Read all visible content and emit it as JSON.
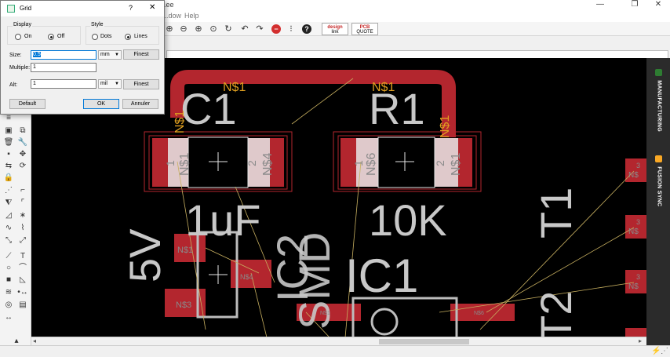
{
  "window": {
    "title": "...ee",
    "minimize": "—",
    "restore": "❐",
    "close": "✕"
  },
  "menu": {
    "items": [
      "...dow",
      "Help"
    ]
  },
  "toolbar": {
    "badges": [
      {
        "top": "design",
        "bottom": "link"
      },
      {
        "top": "PCB",
        "bottom": "QUOTE"
      }
    ]
  },
  "dialog": {
    "title": "Grid",
    "help": "?",
    "close": "✕",
    "display": {
      "label": "Display",
      "on": "On",
      "off": "Off",
      "selected": "Off"
    },
    "style": {
      "label": "Style",
      "dots": "Dots",
      "lines": "Lines",
      "selected": "Lines"
    },
    "size": {
      "label": "Size:",
      "value": "0.5",
      "unit": "mm",
      "finest": "Finest"
    },
    "multiple": {
      "label": "Multiple:",
      "value": "1"
    },
    "alt": {
      "label": "Alt:",
      "value": "1",
      "unit": "mil",
      "finest": "Finest"
    },
    "buttons": {
      "default": "Default",
      "ok": "OK",
      "cancel": "Annuler"
    }
  },
  "right_panel": {
    "manufacturing": {
      "label": "MANUFACTURING",
      "color": "#2e7d32"
    },
    "fusion_sync": {
      "label": "FUSION SYNC",
      "color": "#f9a825"
    }
  },
  "board": {
    "colors": {
      "background": "#000000",
      "copper": "#b3262e",
      "silk_label": "#c8c8c8",
      "net_label": "#e0a020",
      "pad_overlay": "#e6e6e6",
      "airwire": "#c8b060"
    },
    "labels": {
      "c1": "C1",
      "r1": "R1",
      "c1_value": "1uF",
      "r1_value": "10K",
      "ic1": "IC1",
      "ic2": "IC2",
      "smd": "SMD",
      "v5": "5V",
      "t1": "T1",
      "t2": "T2",
      "net_top_left": "N$1",
      "net_top_right": "N$1",
      "net_c1_left": "N$1",
      "net_r1_right": "N$1",
      "c1_pad1": "N$1",
      "c1_pad2": "N$4",
      "r1_pad1": "N$6",
      "r1_pad2": "N$1",
      "pad_one_a": "1",
      "pad_two_a": "2",
      "pad_one_b": "1",
      "pad_two_b": "2",
      "ic_pad_a": "N$1",
      "ic_pad_b": "N$3",
      "ic_pad_c": "N$4",
      "ic1_pad_left": "N$1",
      "ic1_pad_right": "N$6",
      "right_pad_a": "N$",
      "right_pad_b": "N$",
      "right_pad_c": "N$",
      "right_pad_a_num": "3",
      "right_pad_b_num": "3",
      "right_pad_c_num": "3"
    }
  }
}
